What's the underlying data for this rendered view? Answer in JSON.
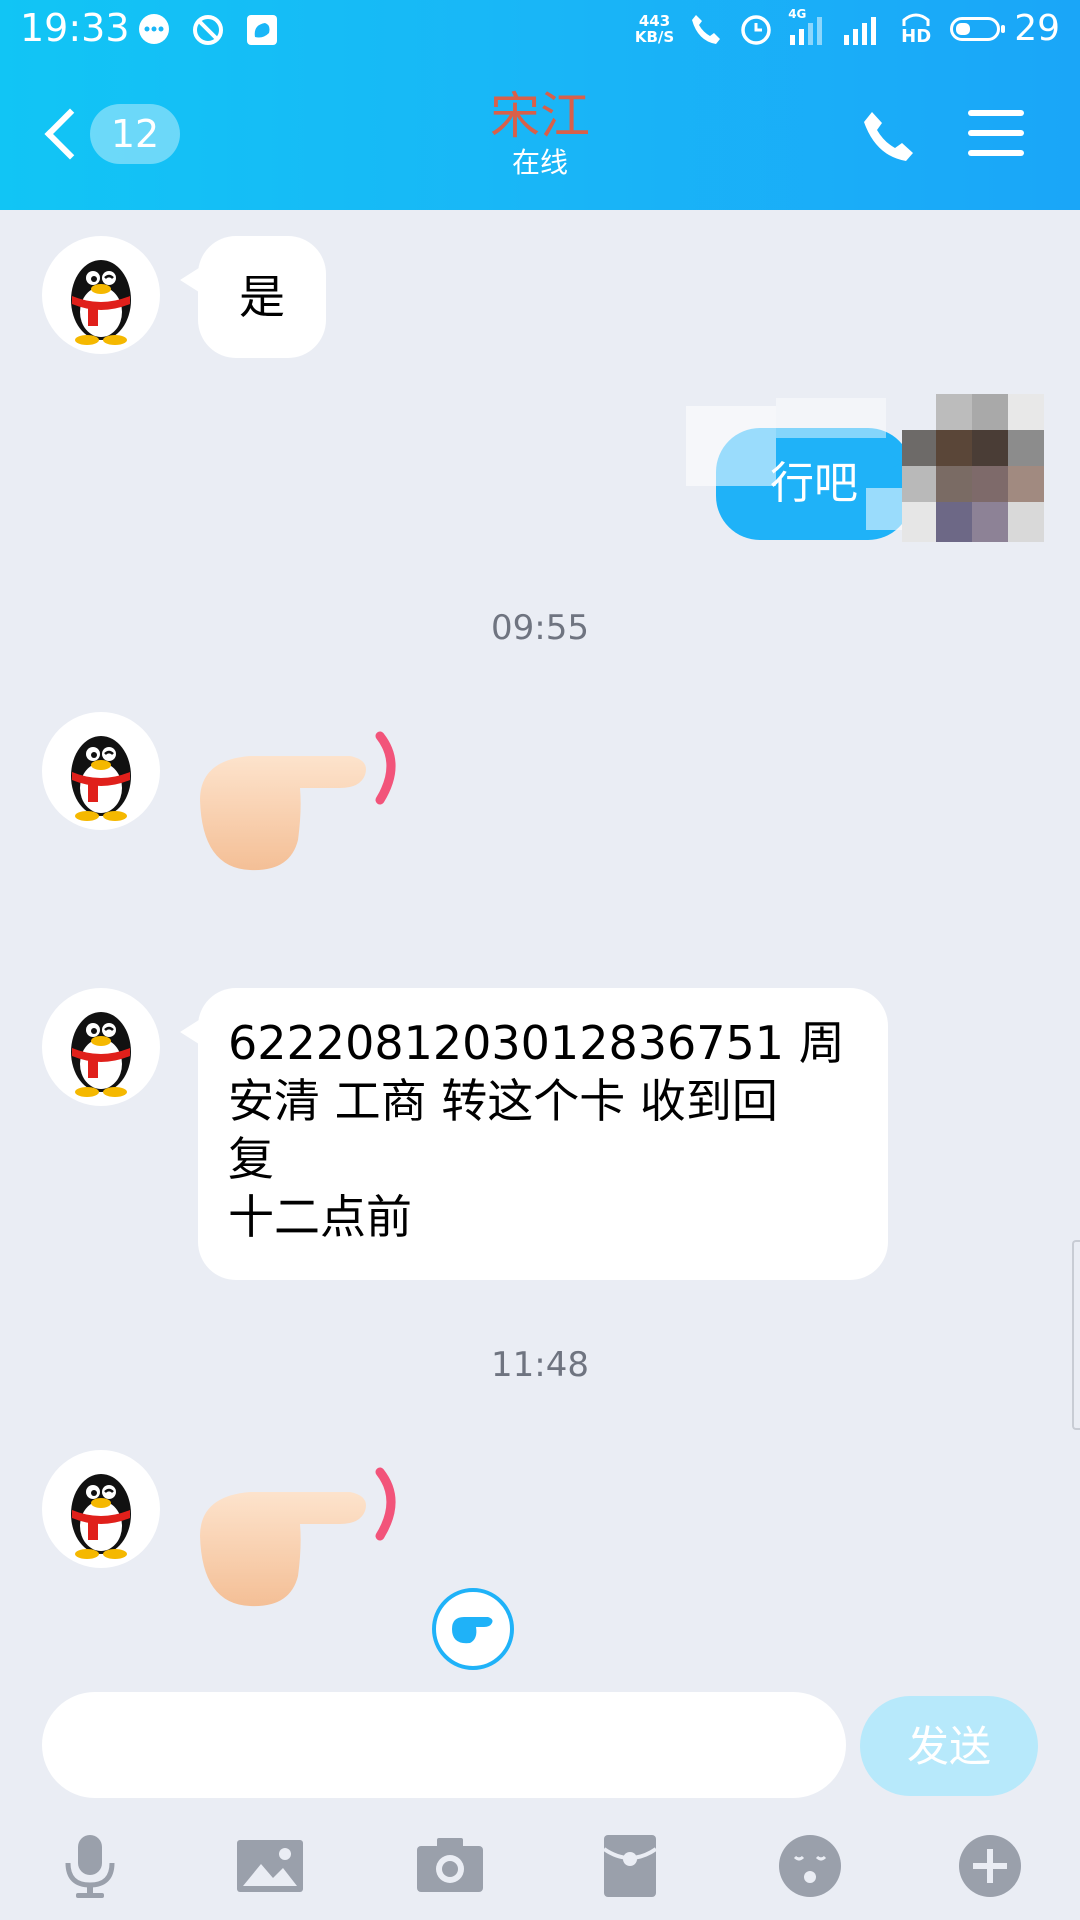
{
  "status_bar": {
    "time": "19:33",
    "net_speed_value": "443",
    "net_speed_unit": "KB/S",
    "network_type": "4G",
    "hd_label": "HD",
    "battery": "29",
    "icons": [
      "message-icon",
      "block-icon",
      "uc-browser-icon",
      "call-icon",
      "alarm-icon",
      "signal-4g-icon",
      "signal-icon",
      "hd-icon",
      "battery-icon"
    ]
  },
  "header": {
    "unread_count": "12",
    "contact_name": "宋江",
    "contact_status": "在线",
    "colors": {
      "bar": "#19b6f7",
      "name": "#d8604a"
    }
  },
  "messages": [
    {
      "from": "other",
      "type": "text",
      "text": "是"
    },
    {
      "from": "self",
      "type": "text",
      "text": "行吧"
    },
    {
      "type": "time",
      "text": "09:55"
    },
    {
      "from": "other",
      "type": "emoji",
      "emoji": "pointing-hand"
    },
    {
      "from": "other",
      "type": "text",
      "lines": [
        "6222081203012836751 周",
        "安清 工商  转这个卡 收到回",
        "复",
        "十二点前"
      ]
    },
    {
      "type": "time",
      "text": "11:48"
    },
    {
      "from": "other",
      "type": "emoji",
      "emoji": "pointing-hand"
    }
  ],
  "input": {
    "value": "",
    "placeholder": "",
    "send_label": "发送"
  },
  "toolbar": [
    "microphone-icon",
    "image-icon",
    "camera-icon",
    "red-packet-icon",
    "emoji-icon",
    "plus-icon"
  ]
}
